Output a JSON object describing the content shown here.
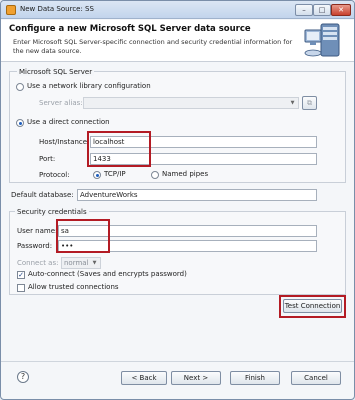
{
  "window": {
    "title": "New Data Source: SS",
    "minimize_glyph": "–",
    "maximize_glyph": "□",
    "close_glyph": "✕"
  },
  "header": {
    "title": "Configure a new Microsoft SQL Server data source",
    "description": "Enter Microsoft SQL Server-specific connection and security credential information for the new data source."
  },
  "server_group": {
    "label": "Microsoft SQL Server",
    "option_network": "Use a network library configuration",
    "server_alias_label": "Server alias:",
    "server_alias_value": "",
    "option_direct": "Use a direct connection",
    "host_label": "Host/Instance:",
    "host_value": "localhost",
    "port_label": "Port:",
    "port_value": "1433",
    "protocol_label": "Protocol:",
    "protocol_tcp": "TCP/IP",
    "protocol_pipes": "Named pipes"
  },
  "default_database": {
    "label": "Default database:",
    "value": "AdventureWorks"
  },
  "security": {
    "label": "Security credentials",
    "username_label": "User name:",
    "username_value": "sa",
    "password_label": "Password:",
    "password_value": "•••",
    "connect_as_label": "Connect as:",
    "connect_as_value": "normal",
    "auto_connect_label": "Auto-connect (Saves and encrypts password)",
    "trusted_label": "Allow trusted connections",
    "auto_connect_checked": true,
    "trusted_checked": false
  },
  "buttons": {
    "test_connection": "Test Connection",
    "help": "?",
    "back": "< Back",
    "next": "Next >",
    "finish": "Finish",
    "cancel": "Cancel"
  },
  "colors": {
    "highlight": "#b31b24",
    "accent": "#1f5fbf"
  },
  "icons": [
    "app-icon",
    "database-server-icon",
    "help-icon",
    "dropdown-arrow-icon"
  ]
}
